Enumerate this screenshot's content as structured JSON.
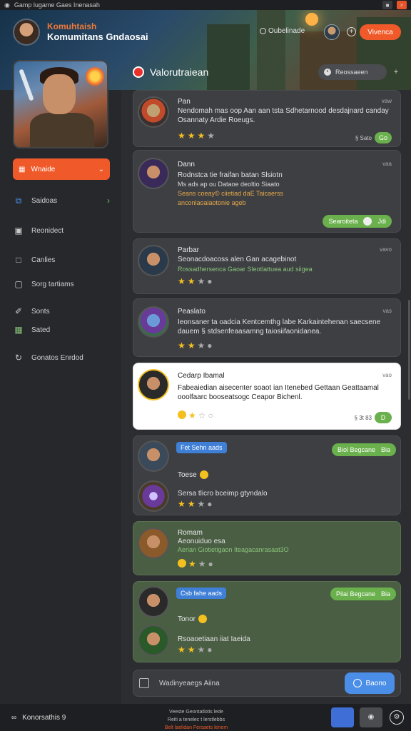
{
  "topbar": {
    "title": "Gamp lugame Gaes Inenasah",
    "icon": "gamepad-icon"
  },
  "header": {
    "title_top": "Komuhtaish",
    "title_main": "Komumitans Gndaosai",
    "status": "Oubelinade",
    "primary_button": "Vivenca",
    "accent": "#f05a2a"
  },
  "sidebar": {
    "active": {
      "label": "Wnaide",
      "icon": "grid-icon"
    },
    "items": [
      {
        "label": "Saidoas",
        "icon": "shield-icon"
      },
      {
        "label": "Reonidect",
        "icon": "terminal-icon"
      },
      {
        "label": "Canlies",
        "icon": "chat-icon"
      },
      {
        "label": "Sorg tartiams",
        "icon": "window-icon"
      },
      {
        "label": "Sonts",
        "icon": "pen-icon"
      },
      {
        "label": "Sated",
        "icon": "calendar-icon"
      },
      {
        "label": "Gonatos Enrdod",
        "icon": "spiral-icon"
      }
    ]
  },
  "main": {
    "title": "Valorutraiean",
    "filter_button": "Reossaeen"
  },
  "cards": [
    {
      "name": "Pan",
      "time": "vaw",
      "text": "Nendomah mas oop Aan aan tsta Sdhetarnood desdajnard canday Osannaty Ardie Roeugs.",
      "rating": 3,
      "counter": "§ Sato",
      "action": "Go"
    },
    {
      "name": "Dann",
      "time": "vaa",
      "text": "Rodnstca tie fraifan batan Slsiotn",
      "sub1": "Ms ads ap ou Dataoe deoltio Siaato",
      "sub2": "Seans coeay© ciietiad daE Taicaerss",
      "sub3": "anconlaoaiaotonie ageb",
      "pill": "Searoiteta",
      "pill2": "Jdi"
    },
    {
      "name": "Parbar",
      "time": "vavo",
      "text": "Seonacdoacoss alen Gan acagebinot",
      "sub": "Rossadhersenca Gaoar Sleotlattuea aud siigea",
      "rating": 2
    },
    {
      "name": "Peaslato",
      "time": "vas",
      "text": "Ieonsaner ta oadcia Kentcemthg labe Karkaintehenan saecsene dauem § stdsenfeaasamng taiosiifaonidanea.",
      "rating": 2
    },
    {
      "name": "Cedarp Ibamal",
      "time": "vao",
      "text": "Fabeaiedian aisecenter soaot ian Itenebed Gettaan Geattaamal ooolfaarc booseatsogc Ceapor Bichenl.",
      "rating": 2,
      "counter": "§ 3t 83",
      "action": "D"
    },
    {
      "tag": "Fet Sehn aads",
      "pill": "Biol Begcane",
      "pill2": "Bia",
      "line1": "Toese",
      "line2": "Sersa tlicro bceimp gtyndalo",
      "rating": 3
    },
    {
      "name": "Romam",
      "text": "Aeonuiduo esa",
      "sub": "Aerian Giotietigaon Iteagacanrasaat3O",
      "rating": 2
    },
    {
      "tag": "Csb fahe aads",
      "pill": "Pilai Begcane",
      "pill2": "Bia",
      "line1": "Tonor",
      "line2": "Rsoaoetiaan iiat Iaeida",
      "rating": 3
    }
  ],
  "composer": {
    "placeholder": "Wadinyeaegs Aiina",
    "send": "Baono"
  },
  "bottombar": {
    "left": "Konorsathis 9",
    "center1": "Veeste Geontatlotis lede",
    "center2": "Reiti a tenelec t lerstlebbs",
    "center3": "Belt laelidan Fersaets lenem"
  }
}
